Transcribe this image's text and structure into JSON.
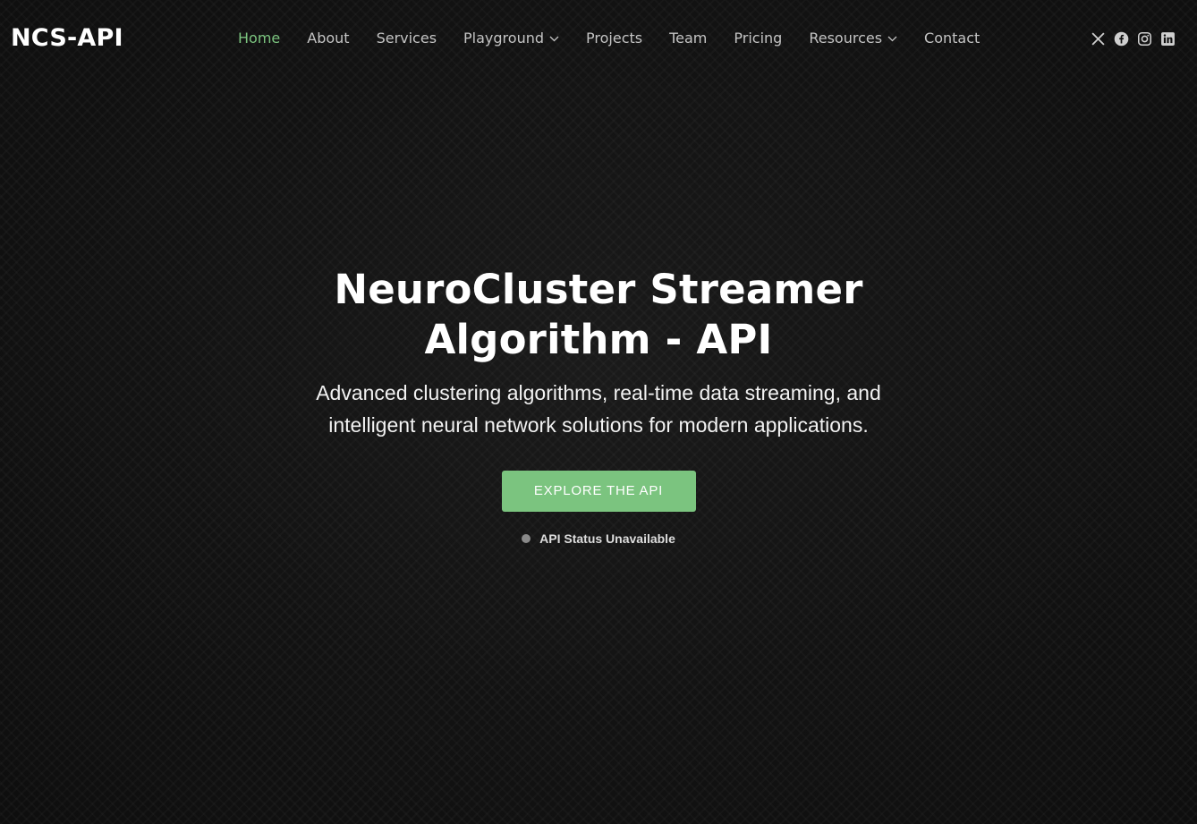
{
  "brand": {
    "logo": "NCS-API"
  },
  "nav": {
    "items": [
      {
        "label": "Home",
        "active": true,
        "dropdown": false
      },
      {
        "label": "About",
        "active": false,
        "dropdown": false
      },
      {
        "label": "Services",
        "active": false,
        "dropdown": false
      },
      {
        "label": "Playground",
        "active": false,
        "dropdown": true
      },
      {
        "label": "Projects",
        "active": false,
        "dropdown": false
      },
      {
        "label": "Team",
        "active": false,
        "dropdown": false
      },
      {
        "label": "Pricing",
        "active": false,
        "dropdown": false
      },
      {
        "label": "Resources",
        "active": false,
        "dropdown": true
      },
      {
        "label": "Contact",
        "active": false,
        "dropdown": false
      }
    ]
  },
  "social": {
    "icons": [
      "x-icon",
      "facebook-icon",
      "instagram-icon",
      "linkedin-icon"
    ]
  },
  "hero": {
    "title": "NeuroCluster Streamer Algorithm - API",
    "subtitle": "Advanced clustering algorithms, real-time data streaming, and intelligent neural network solutions for modern applications.",
    "cta_label": "Explore the API",
    "status_text": "API Status Unavailable"
  },
  "colors": {
    "accent": "#7bc47f",
    "background": "#111111",
    "nav_text": "#c4c4c4",
    "status_dot": "#8a8a8a"
  }
}
